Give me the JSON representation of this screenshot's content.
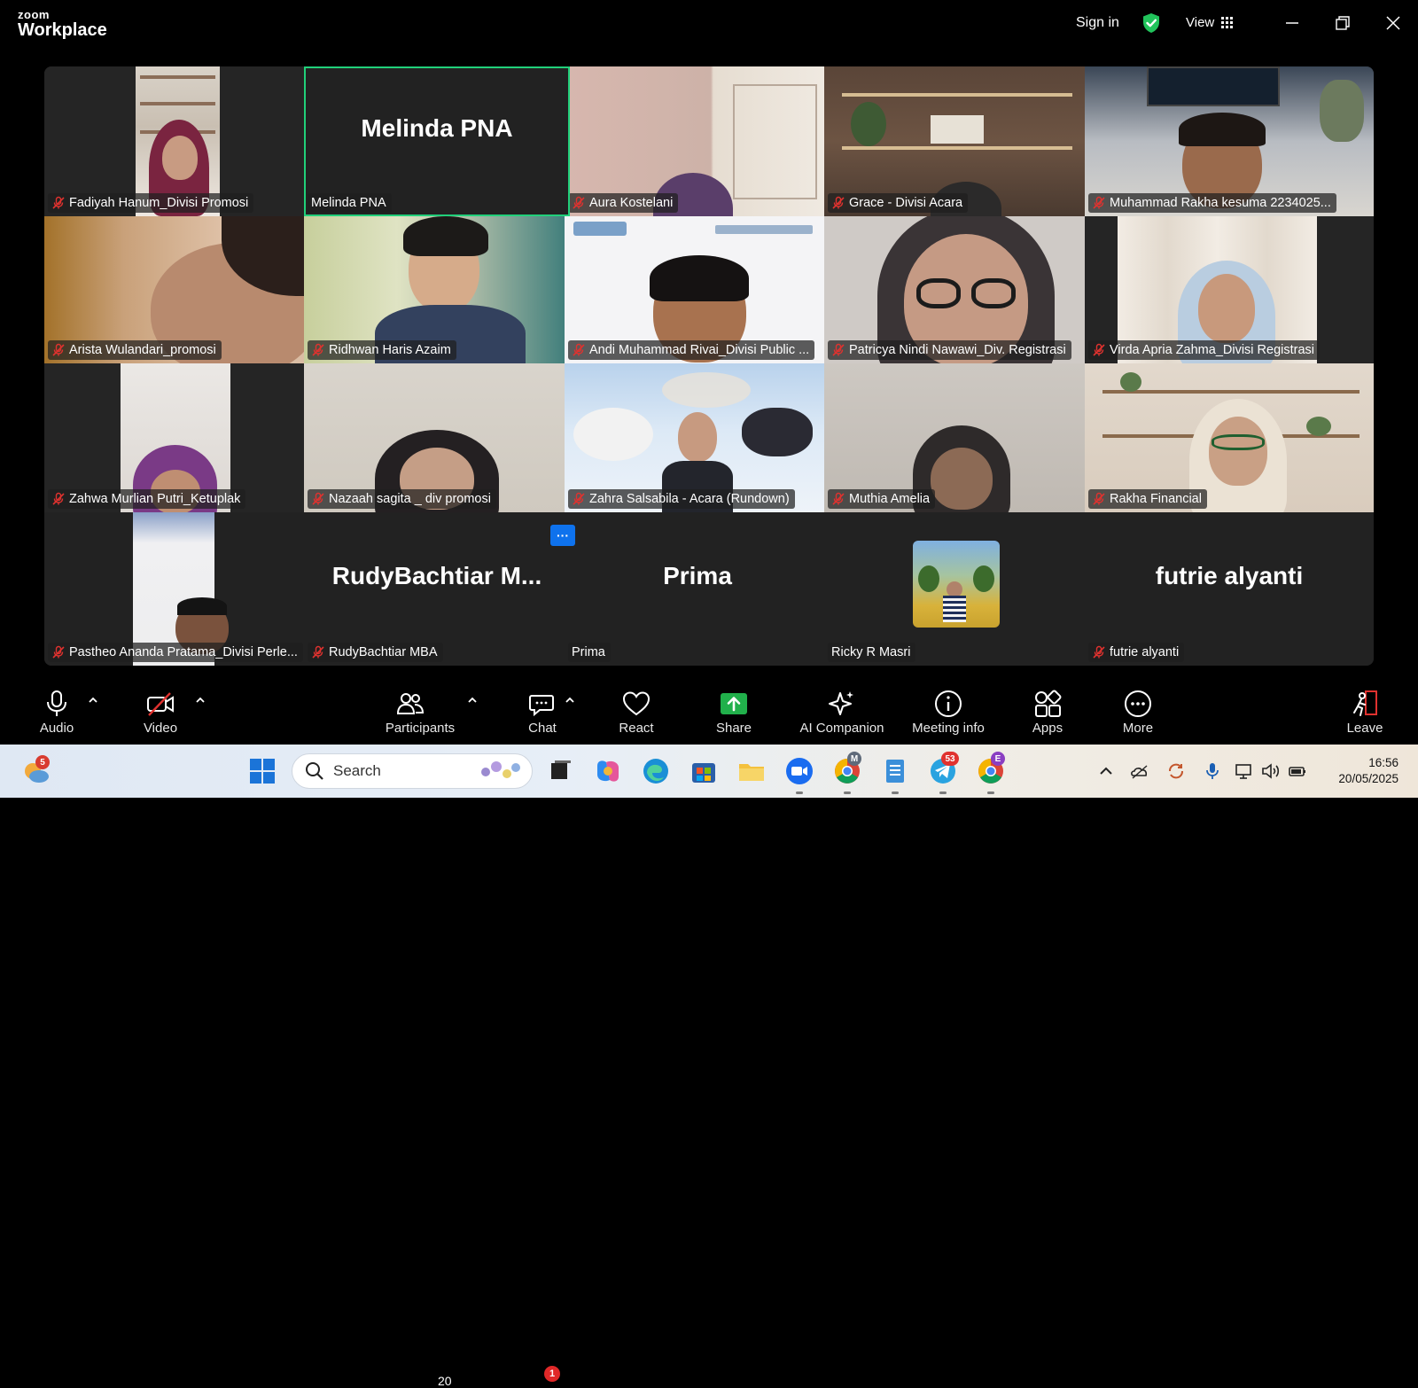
{
  "titlebar": {
    "brand_top": "zoom",
    "brand_bottom": "Workplace",
    "sign_in": "Sign in",
    "view": "View"
  },
  "gallery": {
    "tiles": [
      {
        "name": "Fadiyah Hanum_Divisi Promosi",
        "muted": true
      },
      {
        "name": "Melinda PNA",
        "big": "Melinda PNA",
        "muted": false,
        "active": true
      },
      {
        "name": "Aura Kostelani",
        "muted": true
      },
      {
        "name": "Grace - Divisi Acara",
        "muted": true
      },
      {
        "name": "Muhammad Rakha kesuma 2234025...",
        "muted": true
      },
      {
        "name": "Arista Wulandari_promosi",
        "muted": true
      },
      {
        "name": "Ridhwan Haris Azaim",
        "muted": true
      },
      {
        "name": "Andi Muhammad Rivai_Divisi Public ...",
        "muted": true
      },
      {
        "name": "Patricya  Nindi Nawawi_Div. Registrasi",
        "muted": true
      },
      {
        "name": "Virda Apria Zahma_Divisi Registrasi",
        "muted": true
      },
      {
        "name": "Zahwa Murlian Putri_Ketuplak",
        "muted": true
      },
      {
        "name": "Nazaah sagita _ div promosi",
        "muted": true
      },
      {
        "name": "Zahra Salsabila - Acara (Rundown)",
        "muted": true
      },
      {
        "name": "Muthia Amelia",
        "muted": true
      },
      {
        "name": "Rakha Financial",
        "muted": true
      },
      {
        "name": "Pastheo Ananda Pratama_Divisi Perle...",
        "muted": true
      },
      {
        "name": "RudyBachtiar MBA",
        "big": "RudyBachtiar  M...",
        "muted": true
      },
      {
        "name": "Prima",
        "big": "Prima",
        "muted": false
      },
      {
        "name": "Ricky R Masri",
        "muted": false
      },
      {
        "name": "futrie alyanti",
        "big": "futrie alyanti",
        "muted": true
      }
    ],
    "more_label": "···"
  },
  "toolbar": {
    "audio": "Audio",
    "video": "Video",
    "participants": "Participants",
    "participants_count": "20",
    "chat": "Chat",
    "chat_badge": "1",
    "react": "React",
    "share": "Share",
    "ai_companion": "AI Companion",
    "meeting_info": "Meeting info",
    "apps": "Apps",
    "more": "More",
    "leave": "Leave"
  },
  "taskbar": {
    "weather_badge": "5",
    "search_placeholder": "Search",
    "telegram_badge": "53",
    "chrome_m_badge": "M",
    "chrome_e_badge": "E",
    "time": "16:56",
    "date": "20/05/2025"
  },
  "colors": {
    "active_speaker": "#21d07a",
    "mute_red": "#e0322f",
    "share_green": "#21b04b",
    "accent_blue": "#0e72ed"
  }
}
